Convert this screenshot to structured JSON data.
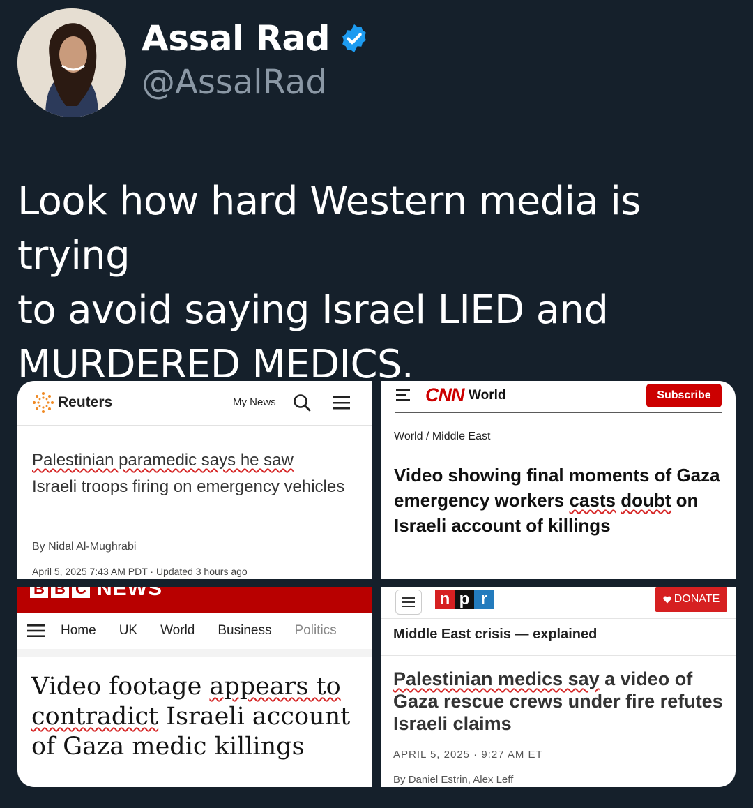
{
  "profile": {
    "name": "Assal Rad",
    "handle": "@AssalRad",
    "verified": true,
    "verified_color": "#1d9bf0"
  },
  "tweet": {
    "text_line1": "Look how hard Western media is trying",
    "text_line2": "to avoid saying Israel LIED and",
    "text_line3": "MURDERED MEDICS."
  },
  "reuters": {
    "brand": "Reuters",
    "my_news": "My News",
    "headline_part1": "Palestinian paramedic says he saw",
    "headline_part2": "Israeli troops firing on emergency vehicles",
    "byline_prefix": "By ",
    "byline_author": "Nidal Al-Mughrabi",
    "date": "April 5, 2025 7:43 AM PDT · Updated 3 hours ago",
    "icons": [
      "reuters-logo-icon",
      "search-icon",
      "menu-icon"
    ]
  },
  "cnn": {
    "brand": "CNN",
    "section": "World",
    "subscribe_label": "Subscribe",
    "breadcrumb": "World  /  Middle East",
    "headline_part1": "Video showing final moments of Gaza emergency workers ",
    "headline_casts": "casts",
    "headline_part2": " ",
    "headline_doubt": "doubt",
    "headline_part3": " on Israeli account of killings",
    "brand_color": "#cc0000"
  },
  "bbc": {
    "news_label": "NEWS",
    "nav": [
      "Home",
      "UK",
      "World",
      "Business",
      "Politics"
    ],
    "headline_part1": "Video footage ",
    "headline_appears": "appears to",
    "headline_contradict": "contradict",
    "headline_part2": " Israeli account of Gaza medic killings",
    "brand_color": "#b80000"
  },
  "npr": {
    "logo_letters": [
      "n",
      "p",
      "r"
    ],
    "donate_label": "DONATE",
    "kicker": "Middle East crisis — explained",
    "headline_underlined": "Palestinian medics say",
    "headline_rest": " a video of Gaza rescue crews under fire refutes Israeli claims",
    "date": "APRIL 5, 2025 · 9:27 AM ET",
    "byline_prefix": "By ",
    "byline_authors": "Daniel Estrin, Alex Leff",
    "logo_colors": [
      "#d62021",
      "#111111",
      "#237bbd"
    ]
  }
}
